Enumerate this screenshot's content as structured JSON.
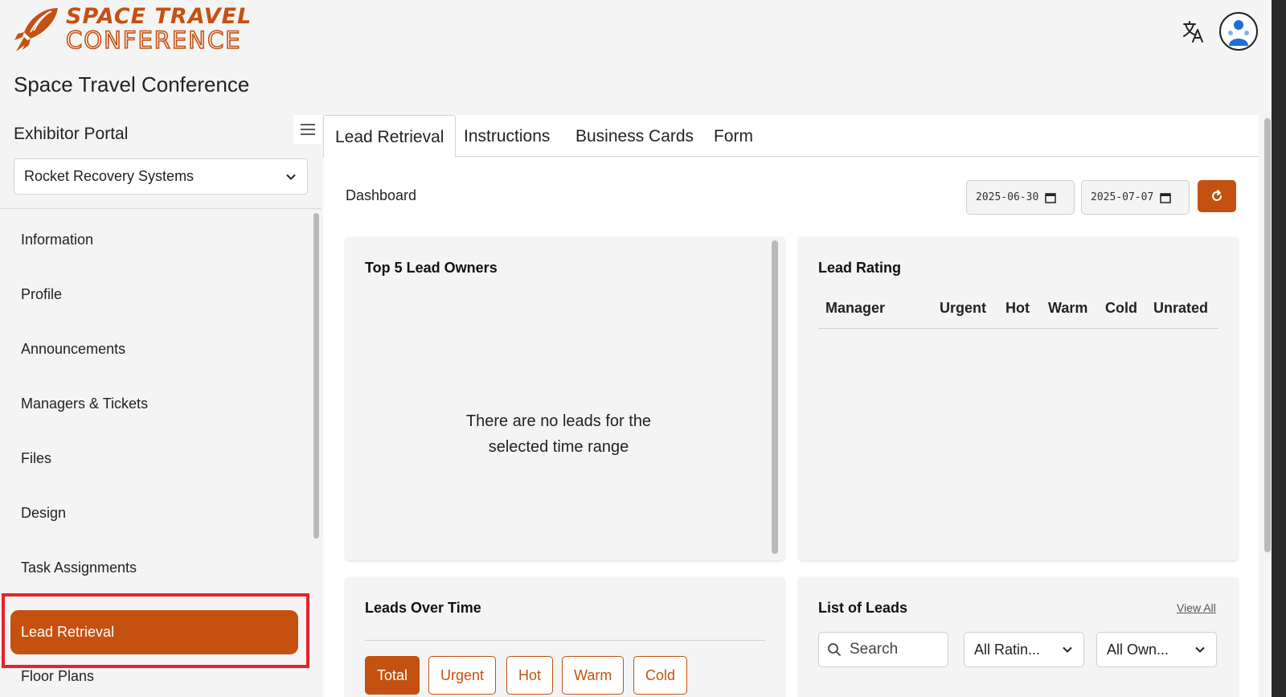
{
  "header": {
    "logo_line1": "SPACE TRAVEL",
    "logo_line2": "CONFERENCE",
    "app_title": "Space Travel Conference",
    "translate_icon": "translate-icon",
    "avatar_icon": "user-avatar-icon"
  },
  "sidebar": {
    "portal_label": "Exhibitor Portal",
    "company_select": "Rocket Recovery Systems",
    "items": [
      {
        "label": "Information"
      },
      {
        "label": "Profile"
      },
      {
        "label": "Announcements"
      },
      {
        "label": "Managers & Tickets"
      },
      {
        "label": "Files"
      },
      {
        "label": "Design"
      },
      {
        "label": "Task Assignments"
      },
      {
        "label": "Lead Retrieval",
        "active": true
      },
      {
        "label": "Floor Plans"
      }
    ]
  },
  "tabs": [
    {
      "label": "Lead Retrieval",
      "active": true
    },
    {
      "label": "Instructions"
    },
    {
      "label": "Business Cards"
    },
    {
      "label": "Form"
    }
  ],
  "dashboard": {
    "label": "Dashboard",
    "start_date": "2025-06-30",
    "end_date": "2025-07-07",
    "refresh_icon": "refresh-icon"
  },
  "top_owners": {
    "title": "Top 5 Lead Owners",
    "empty_line1": "There are no leads for the",
    "empty_line2": "selected time range"
  },
  "lead_rating": {
    "title": "Lead Rating",
    "columns": [
      "Manager",
      "Urgent",
      "Hot",
      "Warm",
      "Cold",
      "Unrated"
    ]
  },
  "leads_over_time": {
    "title": "Leads Over Time",
    "filters": [
      "Total",
      "Urgent",
      "Hot",
      "Warm",
      "Cold"
    ],
    "active_filter": "Total"
  },
  "list_of_leads": {
    "title": "List of Leads",
    "view_all": "View All",
    "search_placeholder": "Search",
    "rating_filter": "All Ratin...",
    "owner_filter": "All Own..."
  },
  "colors": {
    "accent": "#c4510f",
    "highlight": "#e8212b",
    "background": "#f4f4f4"
  }
}
